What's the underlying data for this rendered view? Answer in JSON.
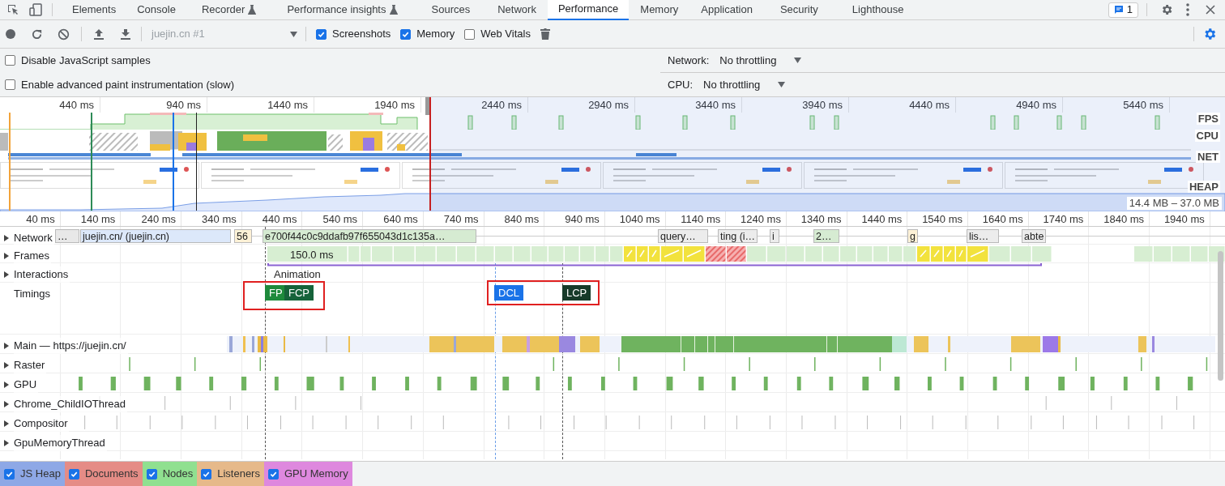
{
  "tabs": [
    {
      "label": "Elements",
      "selected": false,
      "experimental": false
    },
    {
      "label": "Console",
      "selected": false,
      "experimental": false
    },
    {
      "label": "Recorder",
      "selected": false,
      "experimental": true
    },
    {
      "label": "Performance insights",
      "selected": false,
      "experimental": true
    },
    {
      "label": "Sources",
      "selected": false,
      "experimental": false
    },
    {
      "label": "Network",
      "selected": false,
      "experimental": false
    },
    {
      "label": "Performance",
      "selected": true,
      "experimental": false
    },
    {
      "label": "Memory",
      "selected": false,
      "experimental": false
    },
    {
      "label": "Application",
      "selected": false,
      "experimental": false
    },
    {
      "label": "Security",
      "selected": false,
      "experimental": false
    },
    {
      "label": "Lighthouse",
      "selected": false,
      "experimental": false
    }
  ],
  "issues_badge": "1",
  "toolbar": {
    "recording": "juejin.cn #1",
    "checkboxes": [
      {
        "label": "Screenshots",
        "checked": true
      },
      {
        "label": "Memory",
        "checked": true
      },
      {
        "label": "Web Vitals",
        "checked": false
      }
    ]
  },
  "settings": {
    "options": [
      {
        "label": "Disable JavaScript samples",
        "checked": false
      },
      {
        "label": "Enable advanced paint instrumentation (slow)",
        "checked": false
      }
    ],
    "throttling": [
      {
        "label": "Network:",
        "value": "No throttling"
      },
      {
        "label": "CPU:",
        "value": "No throttling"
      }
    ]
  },
  "overview": {
    "ticks": [
      "440 ms",
      "940 ms",
      "1440 ms",
      "1940 ms",
      "2440 ms",
      "2940 ms",
      "3440 ms",
      "3940 ms",
      "4440 ms",
      "4940 ms",
      "5440 ms"
    ],
    "lanes": [
      "FPS",
      "CPU",
      "NET",
      "HEAP"
    ],
    "heap_range": "14.4 MB – 37.0 MB"
  },
  "ruler": [
    "40 ms",
    "140 ms",
    "240 ms",
    "340 ms",
    "440 ms",
    "540 ms",
    "640 ms",
    "740 ms",
    "840 ms",
    "940 ms",
    "1040 ms",
    "1140 ms",
    "1240 ms",
    "1340 ms",
    "1440 ms",
    "1540 ms",
    "1640 ms",
    "1740 ms",
    "1840 ms",
    "1940 ms"
  ],
  "tracks": [
    {
      "kind": "network",
      "name": "Network",
      "expanded": false,
      "requests": [
        {
          "label": "…",
          "color": "#e8e8e8"
        },
        {
          "label": "juejin.cn/ (juejin.cn)",
          "color": "#dce8fa"
        },
        {
          "label": "56",
          "color": "#fdf1d6"
        },
        {
          "label": "e700f44c0c9ddafb97f655043d1c135a…",
          "color": "#d6ebd2"
        },
        {
          "label": "query…",
          "color": "#ececec"
        },
        {
          "label": "ting (i…",
          "color": "#ececec"
        },
        {
          "label": "i",
          "color": "#ececec"
        },
        {
          "label": "2…",
          "color": "#d6ebd2"
        },
        {
          "label": "g",
          "color": "#fdf1d6"
        },
        {
          "label": "lis…",
          "color": "#ececec"
        },
        {
          "label": "abte",
          "color": "#ececec"
        }
      ]
    },
    {
      "kind": "frames",
      "name": "Frames",
      "expanded": false,
      "first_frame": "150.0 ms"
    },
    {
      "kind": "interactions",
      "name": "Interactions",
      "expanded": false,
      "interaction": "Animation"
    },
    {
      "kind": "timings",
      "name": "Timings",
      "markers": [
        {
          "label": "FP",
          "color": "#1e8a3c"
        },
        {
          "label": "FCP",
          "color": "#16633a"
        },
        {
          "label": "DCL",
          "color": "#1a73e8"
        },
        {
          "label": "LCP",
          "color": "#163a29"
        }
      ]
    },
    {
      "kind": "main",
      "name": "Main — https://juejin.cn/",
      "expanded": false
    },
    {
      "kind": "thread",
      "name": "Raster",
      "expanded": false
    },
    {
      "kind": "thread",
      "name": "GPU",
      "expanded": false
    },
    {
      "kind": "thread",
      "name": "Chrome_ChildIOThread",
      "expanded": false
    },
    {
      "kind": "thread",
      "name": "Compositor",
      "expanded": false
    },
    {
      "kind": "thread",
      "name": "GpuMemoryThread",
      "expanded": false
    }
  ],
  "counters": [
    {
      "label": "JS Heap",
      "checked": true,
      "color": "#8ea8e6"
    },
    {
      "label": "Documents",
      "checked": true,
      "color": "#e58c86"
    },
    {
      "label": "Nodes",
      "checked": true,
      "color": "#90e090"
    },
    {
      "label": "Listeners",
      "checked": true,
      "color": "#e6b98a"
    },
    {
      "label": "GPU Memory",
      "checked": true,
      "color": "#de88de"
    }
  ]
}
